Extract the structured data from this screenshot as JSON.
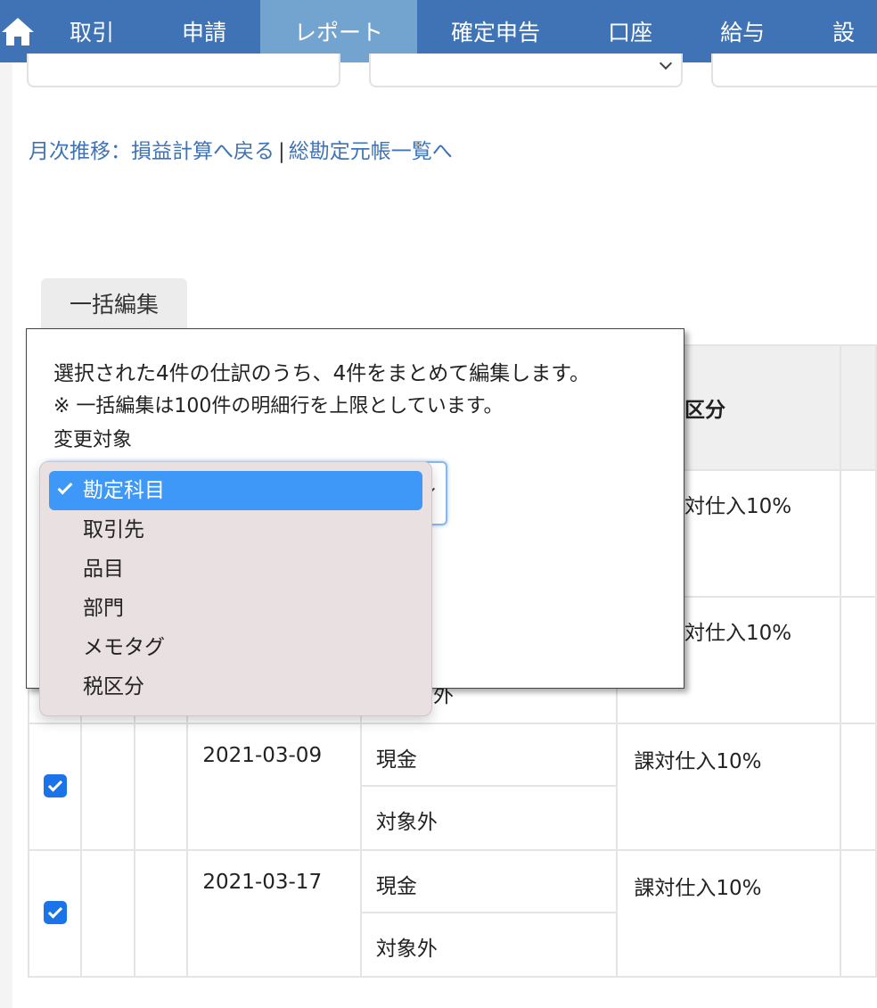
{
  "nav": {
    "items": [
      {
        "label": "取引"
      },
      {
        "label": "申請"
      },
      {
        "label": "レポート",
        "active": true
      },
      {
        "label": "確定申告"
      },
      {
        "label": "口座"
      },
      {
        "label": "給与"
      },
      {
        "label": "設"
      }
    ]
  },
  "links": {
    "back_label": "月次推移：損益計算へ戻る",
    "separator": "|",
    "ledger_label": "総勘定元帳一覧へ"
  },
  "bulk_edit_button": "一括編集",
  "popover": {
    "line1": "選択された4件の仕訳のうち、4件をまとめて編集します。",
    "line2": "※ 一括編集は100件の明細行を上限としています。",
    "line3": "変更対象"
  },
  "dropdown": {
    "options": [
      "勘定科目",
      "取引先",
      "品目",
      "部門",
      "メモタグ",
      "税区分"
    ],
    "selected": "勘定科目"
  },
  "table": {
    "header_tax_partial": "区分",
    "partial_rows": [
      {
        "tax_partial": "対仕入10%"
      },
      {
        "tax_partial": "対仕入10%"
      }
    ],
    "under_menu_partial": "外",
    "rows": [
      {
        "checked": true,
        "date": "2021-03-09",
        "account": "現金",
        "tax_type": "対象外",
        "tax_class": "課対仕入10%"
      },
      {
        "checked": true,
        "date": "2021-03-17",
        "account": "現金",
        "tax_type": "対象外",
        "tax_class": "課対仕入10%"
      }
    ]
  },
  "colors": {
    "nav_bg": "#3f73b6",
    "nav_active": "#73a3cf",
    "link": "#3f73b6",
    "checkbox": "#1a73e8",
    "menu_selected": "#3e98f7"
  }
}
